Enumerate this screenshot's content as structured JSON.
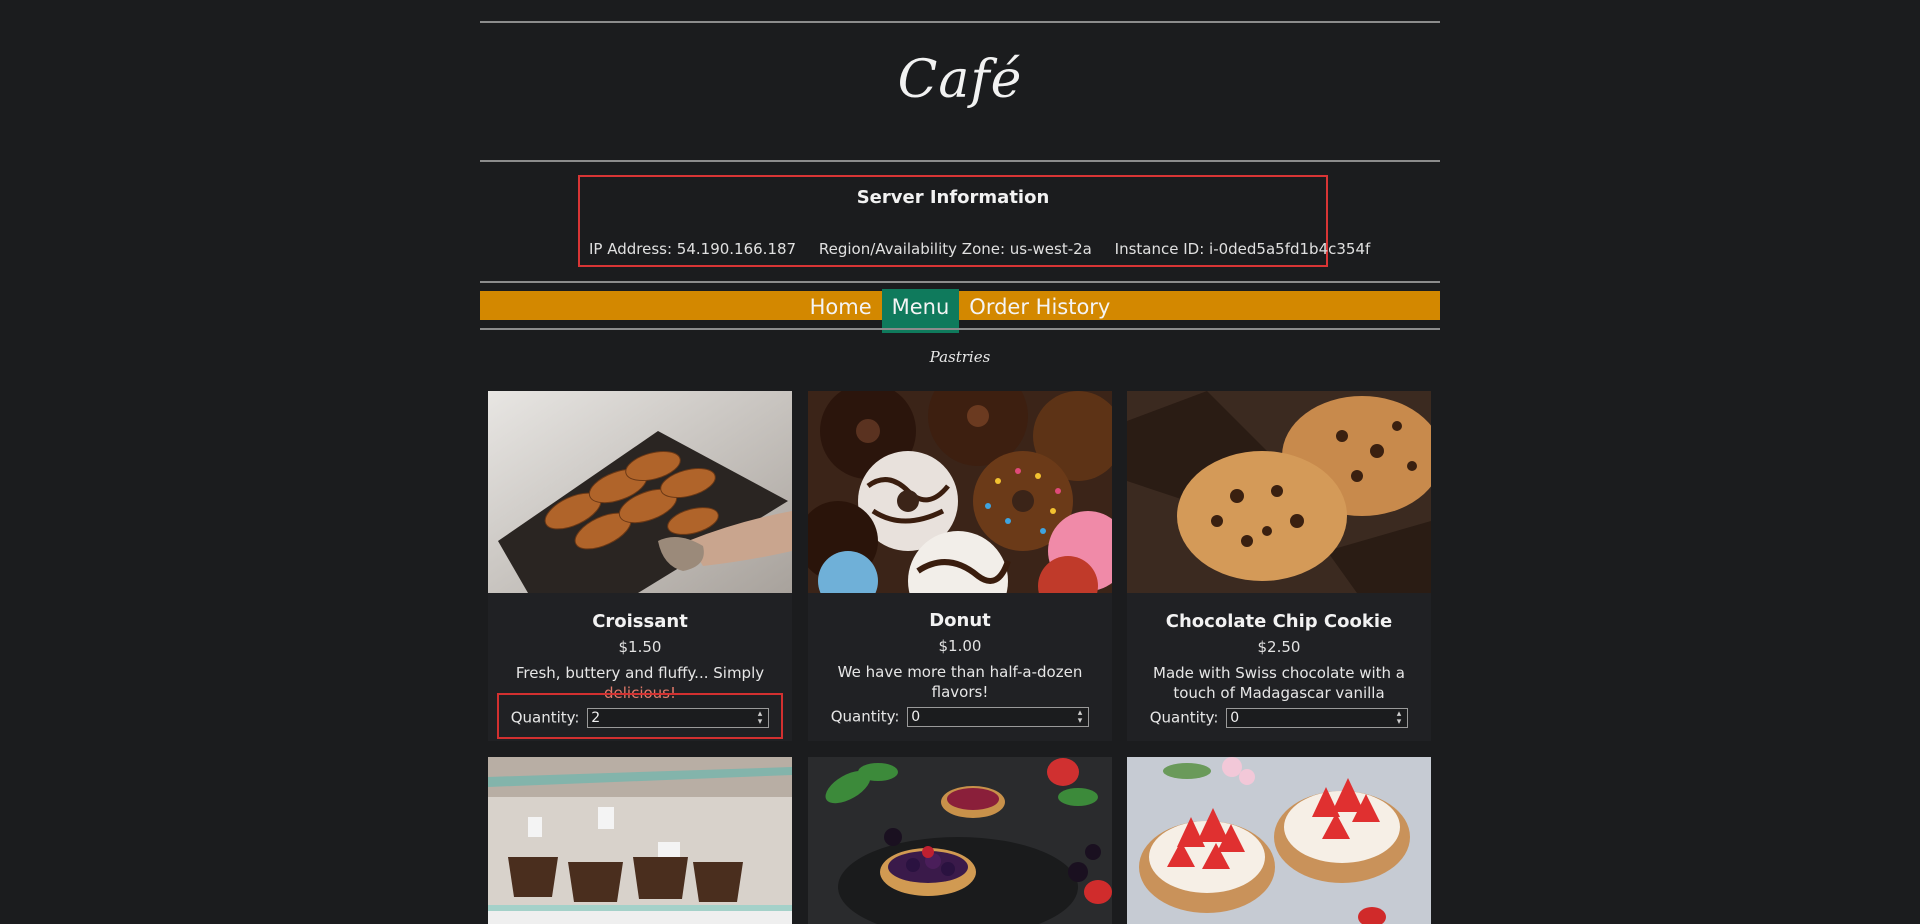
{
  "header": {
    "title": "Café"
  },
  "server": {
    "heading": "Server Information",
    "ip": "IP Address: 54.190.166.187",
    "zone": "Region/Availability Zone: us-west-2a",
    "instance": "Instance ID: i-0ded5a5fd1b4c354f"
  },
  "nav": {
    "items": [
      "Home",
      "Menu",
      "Order History"
    ],
    "active": "Menu"
  },
  "section": {
    "title": "Pastries"
  },
  "products": [
    {
      "name": "Croissant",
      "price": "$1.50",
      "desc_a": "Fresh, buttery and fluffy... Simply",
      "desc_b": "delicious!",
      "qty_label": "Quantity:",
      "qty": "2"
    },
    {
      "name": "Donut",
      "price": "$1.00",
      "desc_a": "We have more than half-a-dozen",
      "desc_b": "flavors!",
      "qty_label": "Quantity:",
      "qty": "0"
    },
    {
      "name": "Chocolate Chip Cookie",
      "price": "$2.50",
      "desc_a": "Made with Swiss chocolate with a",
      "desc_b": "touch of Madagascar vanilla",
      "qty_label": "Quantity:",
      "qty": "0"
    }
  ],
  "row2": [
    {
      "image": "muffins-in-display-case"
    },
    {
      "image": "berry-tartlets"
    },
    {
      "image": "strawberry-tarts"
    }
  ],
  "colors": {
    "accent": "#d38800",
    "active_tab": "#0f7a5c",
    "highlight": "#d83535",
    "background": "#1b1c1e"
  }
}
